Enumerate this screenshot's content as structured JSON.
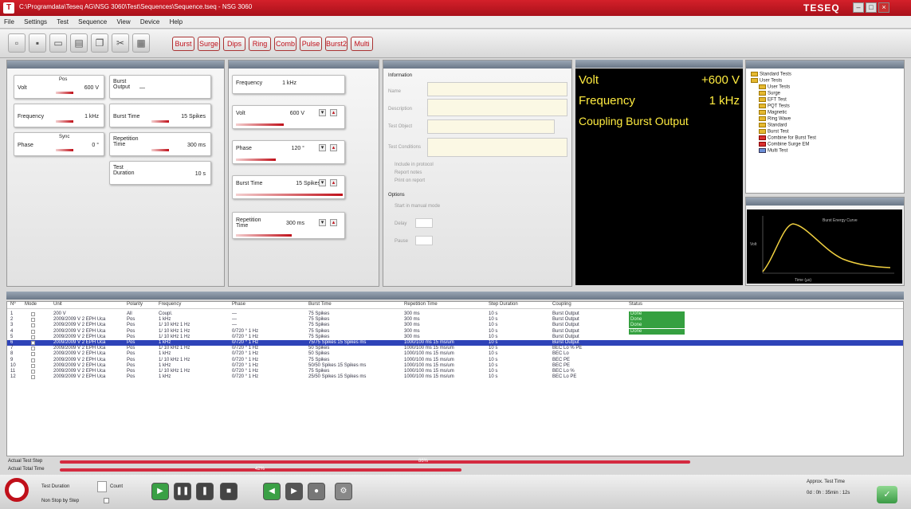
{
  "window": {
    "title": "C:\\Programdata\\Teseq AG\\NSG 3060\\Test\\Sequences\\Sequence.tseq - NSG 3060",
    "brand": "TESEQ",
    "icon_letter": "T"
  },
  "menu": [
    "File",
    "Settings",
    "Test",
    "Sequence",
    "View",
    "Device",
    "Help"
  ],
  "toolbar": {
    "buttons": [
      "Burst",
      "Surge",
      "Dips",
      "Ring",
      "Comb",
      "Pulse",
      "Burst2",
      "Multi"
    ]
  },
  "quick_panel": {
    "volt": {
      "label": "Volt",
      "sub": "Pos",
      "value": "600 V"
    },
    "frequency": {
      "label": "Frequency",
      "value": "1 kHz"
    },
    "phase": {
      "label": "Phase",
      "sub": "Sync",
      "value": "0 °"
    },
    "burst_output": {
      "label": "Burst Output",
      "value": "—"
    },
    "burst_time": {
      "label": "Burst Time",
      "value": "15 Spikes"
    },
    "repetition_time": {
      "label": "Repetition Time",
      "value": "300 ms"
    },
    "test_duration": {
      "label": "Test Duration",
      "value": "10 s"
    }
  },
  "sweep_panel": {
    "items": [
      {
        "label": "Frequency",
        "value": "1 kHz"
      },
      {
        "label": "Volt",
        "value": "600 V"
      },
      {
        "label": "Phase",
        "value": "120 °"
      },
      {
        "label": "Burst Time",
        "value": "15 Spikes"
      },
      {
        "label": "Repetition Time",
        "value": "300 ms"
      }
    ]
  },
  "info_panel": {
    "section": "Information",
    "fields": [
      "Name",
      "Description",
      "Test Object",
      "Test Conditions"
    ],
    "checks": [
      "Include in protocol",
      "Report notes",
      "Print on report"
    ],
    "options_title": "Options",
    "options": [
      "Start in manual mode",
      "Delay",
      "Pause"
    ]
  },
  "monitor": {
    "volt_label": "Volt",
    "volt_value": "+600 V",
    "freq_label": "Frequency",
    "freq_value": "1 kHz",
    "coupling": "Coupling Burst Output"
  },
  "tree": {
    "items": [
      {
        "label": "Standard Tests",
        "kind": "folder"
      },
      {
        "label": "User Tests",
        "kind": "folder"
      },
      {
        "label": "User Tests",
        "kind": "folder"
      },
      {
        "label": "Surge",
        "kind": "folder"
      },
      {
        "label": "EFT Test",
        "kind": "folder"
      },
      {
        "label": "PQT Tests",
        "kind": "folder"
      },
      {
        "label": "Magnetic",
        "kind": "folder"
      },
      {
        "label": "Ring Wave",
        "kind": "folder"
      },
      {
        "label": "Standard",
        "kind": "folder"
      },
      {
        "label": "Burst Test",
        "kind": "folder"
      },
      {
        "label": "Combine for Burst Test",
        "kind": "red"
      },
      {
        "label": "Combine Surge EM",
        "kind": "red"
      },
      {
        "label": "Multi Test",
        "kind": "blue"
      }
    ]
  },
  "graph": {
    "title": "Burst Energy Curve",
    "xlabel": "Time (µs)",
    "ylabel": "Volt"
  },
  "table": {
    "headers": [
      "Nº",
      "Mode",
      "Unit",
      "Polarity",
      "Frequency",
      "Phase",
      "Burst Time",
      "Repetition Time",
      "Step Duration",
      "Coupling",
      "Status"
    ],
    "rows": [
      [
        "1",
        "",
        "200 V",
        "All",
        "Coupl.",
        "—",
        "75 Spikes",
        "300 ms",
        "10 s",
        "Burst Output",
        "Done"
      ],
      [
        "2",
        "",
        "2009/2009 V 2 ЕРН Uca",
        "Pos",
        "1 kHz",
        "—",
        "75 Spikes",
        "300 ms",
        "10 s",
        "Burst Output",
        "Done"
      ],
      [
        "3",
        "",
        "2009/2009 V 2 ЕРН Uca",
        "Pos",
        "1/ 10 kHz 1 Hz",
        "—",
        "75 Spikes",
        "300 ms",
        "10 s",
        "Burst Output",
        "Done"
      ],
      [
        "4",
        "",
        "2009/2009 V 2 ЕРН Uca",
        "Pos",
        "1/ 10 kHz 1 Hz",
        "0/720 ° 1 Hz",
        "75 Spikes",
        "300 ms",
        "10 s",
        "Burst Output",
        "Done"
      ],
      [
        "5",
        "",
        "2009/2009 V 2 ЕРН Uca",
        "Pos",
        "1/ 10 kHz 1 Hz",
        "0/720 ° 1 Hz",
        "75 Spikes",
        "300 ms",
        "10 s",
        "Burst Output",
        ""
      ],
      [
        "6",
        "",
        "2009/2009 V 2 ЕРН Uca",
        "Pos",
        "1 kHz",
        "0/720 ° 1 Hz",
        "75/75 Spikes 15 Spikes ms",
        "1000/100 ms 15 ms/um",
        "10 s",
        "Burst Output",
        ""
      ],
      [
        "7",
        "",
        "2009/2009 V 2 ЕРН Uca",
        "Pos",
        "1/ 10 kHz 1 Hz",
        "0/720 ° 1 Hz",
        "50 Spikes",
        "1000/100 ms 15 ms/um",
        "10 s",
        "BEC Lo % PE",
        ""
      ],
      [
        "8",
        "",
        "2009/2009 V 2 ЕРН Uca",
        "Pos",
        "1 kHz",
        "0/720 ° 1 Hz",
        "50 Spikes",
        "1000/100 ms 15 ms/um",
        "10 s",
        "BEC Lo",
        ""
      ],
      [
        "9",
        "",
        "2009/2009 V 2 ЕРН Uca",
        "Pos",
        "1/ 10 kHz 1 Hz",
        "0/720 ° 1 Hz",
        "75 Spikes",
        "1000/100 ms 15 ms/um",
        "10 s",
        "BEC PE",
        ""
      ],
      [
        "10",
        "",
        "2009/2009 V 2 ЕРН Uca",
        "Pos",
        "1 kHz",
        "0/720 ° 1 Hz",
        "50/50 Spikes 15 Spikes ms",
        "1000/100 ms 15 ms/um",
        "10 s",
        "BEC PE",
        ""
      ],
      [
        "11",
        "",
        "2009/2009 V 2 ЕРН Uca",
        "Pos",
        "1/ 10 kHz 1 Hz",
        "0/720 ° 1 Hz",
        "75 Spikes",
        "1000/100 ms 15 ms/um",
        "10 s",
        "BEC Lo %",
        ""
      ],
      [
        "12",
        "",
        "2009/2009 V 2 ЕРН Uca",
        "Pos",
        "1 kHz",
        "0/720 ° 1 Hz",
        "25/50 Spikes 15 Spikes ms",
        "1000/100 ms 15 ms/um",
        "10 s",
        "BEC Lo PE",
        ""
      ]
    ],
    "selected_row": 5
  },
  "progress": {
    "test_step_label": "Actual Test Step",
    "test_step_fraction": 0.86,
    "test_step_text": "86%",
    "total_label": "Actual Total Time",
    "total_fraction": 0.42,
    "total_text": "42%"
  },
  "bottom": {
    "test_duration_label": "Test Duration",
    "count_label": "Count",
    "non_stop_label": "Non Stop by Step",
    "approx_label": "Approx. Test Time",
    "approx_value": "0d : 0h : 35min : 12s"
  }
}
